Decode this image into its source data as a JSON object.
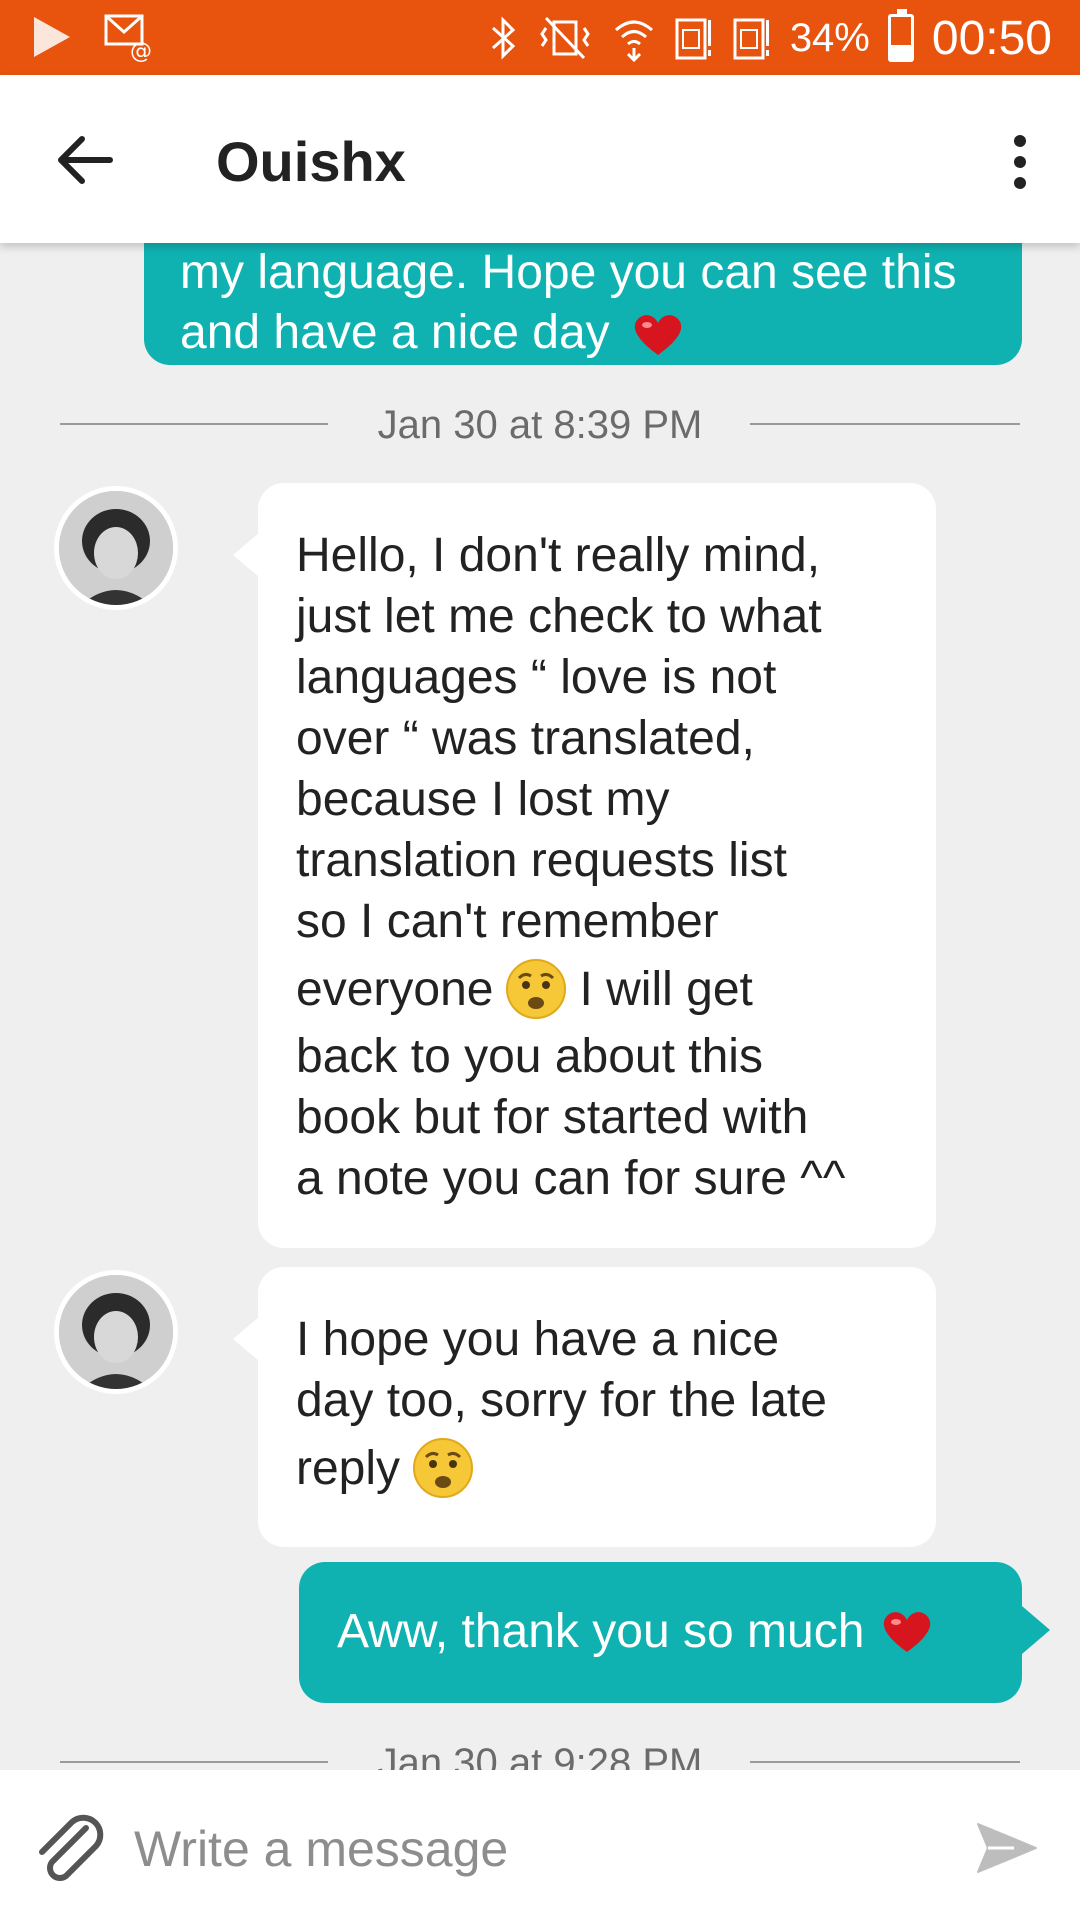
{
  "status_bar": {
    "battery": "34%",
    "time": "00:50",
    "icons": [
      "play-icon",
      "mail-notification-icon",
      "bluetooth-icon",
      "vibrate-icon",
      "wifi-icon",
      "sim1-icon",
      "sim2-icon",
      "battery-icon"
    ]
  },
  "header": {
    "title": "Ouishx"
  },
  "messages": [
    {
      "direction": "out",
      "text": "my language. Hope you can see this and have a nice day",
      "emoji": "heart"
    },
    {
      "type": "date",
      "text": "Jan 30 at 8:39 PM"
    },
    {
      "direction": "in",
      "lines": [
        "Hello, I don't really mind,",
        "just let me check to what",
        "languages “ love is not",
        "over “ was translated,",
        "because I lost my",
        "translation requests list",
        "so I can't remember",
        "everyone",
        "I will get",
        "back to you about this",
        "book but for started with",
        "a note you can for sure ^^"
      ],
      "emoji": "anxious-face"
    },
    {
      "direction": "in",
      "lines": [
        "I hope you have a nice",
        "day too, sorry for the late",
        "reply"
      ],
      "emoji": "anxious-face"
    },
    {
      "direction": "out",
      "text": "Aww, thank you so much",
      "emoji": "heart"
    },
    {
      "type": "date",
      "text": "Jan 30 at 9:28 PM"
    }
  ],
  "composer": {
    "placeholder": "Write a message"
  },
  "colors": {
    "status_bar": "#e8530e",
    "outgoing_bubble": "#10b2b1",
    "incoming_bubble": "#ffffff",
    "chat_background": "#efefef"
  }
}
